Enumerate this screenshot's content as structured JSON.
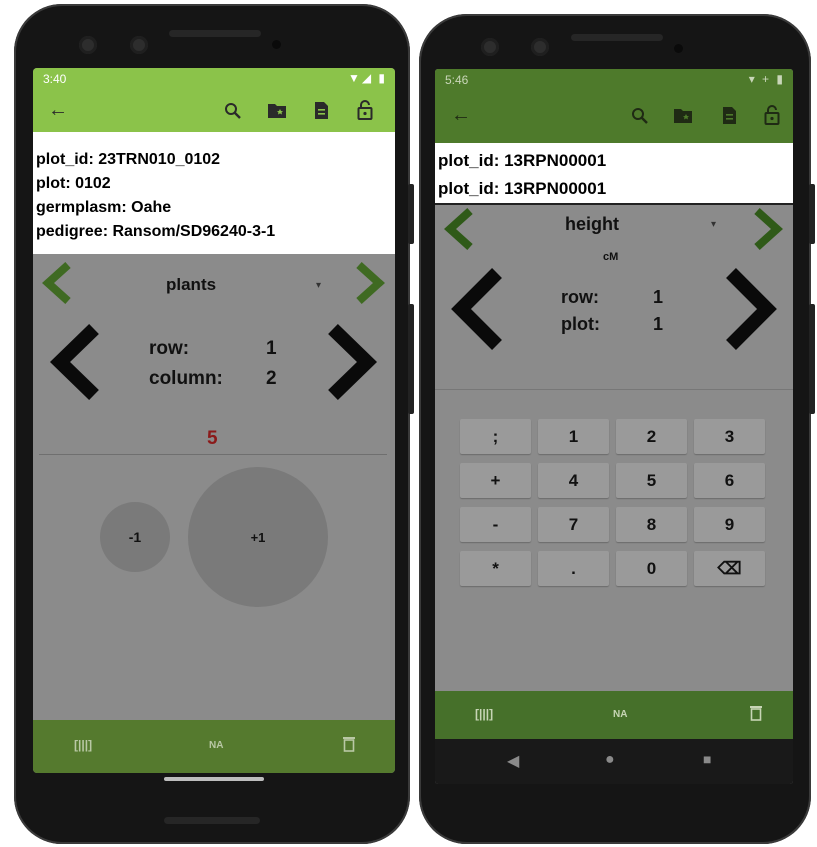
{
  "left_phone": {
    "status": {
      "time": "3:40",
      "icons": "▼◢ ▮"
    },
    "toolbar": {
      "icons": [
        "arrow-left-icon",
        "search-icon",
        "folder-star-icon",
        "document-icon",
        "lock-open-icon"
      ]
    },
    "info": {
      "line1": "plot_id: 23TRN010_0102",
      "line2": "plot: 0102",
      "line3": "germplasm: Oahe",
      "line4": "pedigree: Ransom/SD96240-3-1"
    },
    "trait": {
      "name": "plants",
      "caret": "▾"
    },
    "position": {
      "row_label": "row:",
      "row_value": "1",
      "col_label": "column:",
      "col_value": "2"
    },
    "value": "5",
    "counter": {
      "minus": "-1",
      "plus": "+1"
    },
    "bottom": {
      "na": "NA",
      "barcode": "[|||]",
      "delete": "🗑"
    },
    "colors": {
      "primary": "#8bc34a",
      "primary_dark": "#7db23f",
      "bottom_bar": "#557a2e",
      "value": "#8b1a1a"
    }
  },
  "right_phone": {
    "status": {
      "time": "5:46",
      "icons": "▾ + ▮"
    },
    "toolbar": {
      "icons": [
        "arrow-left-icon",
        "search-icon",
        "folder-star-icon",
        "document-icon",
        "lock-open-icon"
      ]
    },
    "info": {
      "line1": "plot_id: 13RPN00001",
      "line2": "plot_id: 13RPN00001"
    },
    "trait": {
      "name": "height",
      "unit": "cM",
      "caret": "▾"
    },
    "position": {
      "row_label": "row:",
      "row_value": "1",
      "plot_label": "plot:",
      "plot_value": "1"
    },
    "keypad": [
      [
        ";",
        "1",
        "2",
        "3"
      ],
      [
        "+",
        "4",
        "5",
        "6"
      ],
      [
        "-",
        "7",
        "8",
        "9"
      ],
      [
        "*",
        ".",
        "0",
        "⌫"
      ]
    ],
    "bottom": {
      "na": "NA",
      "barcode": "[|||]",
      "delete": "🗑"
    },
    "nav": {
      "back": "◀",
      "home": "●",
      "recents": "■"
    },
    "colors": {
      "primary": "#4e7a2b",
      "primary_dark": "#3f6a22",
      "bottom_bar": "#46702a"
    }
  }
}
